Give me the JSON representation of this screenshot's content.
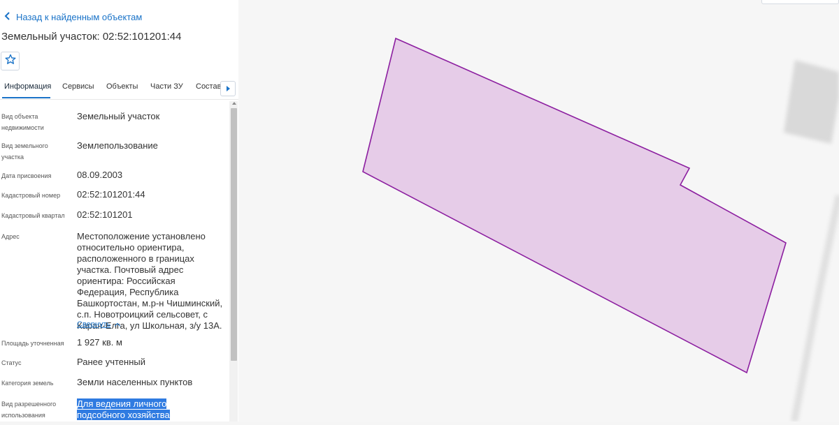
{
  "panel": {
    "back_label": "Назад к найденным объектам",
    "title": "Земельный участок: 02:52:101201:44",
    "tabs": [
      {
        "label": "Информация",
        "active": true
      },
      {
        "label": "Сервисы"
      },
      {
        "label": "Объекты"
      },
      {
        "label": "Части ЗУ"
      },
      {
        "label": "Состав"
      }
    ],
    "fields": [
      {
        "label": "Вид объекта недвижимости",
        "value": "Земельный участок"
      },
      {
        "label": "Вид земельного участка",
        "value": "Землепользование"
      },
      {
        "label": "Дата присвоения",
        "value": "08.09.2003"
      },
      {
        "label": "Кадастровый номер",
        "value": "02:52:101201:44"
      },
      {
        "label": "Кадастровый квартал",
        "value": "02:52:101201"
      },
      {
        "label": "Адрес",
        "value": "Местоположение установлено относительно ориентира, расположенного в границах участка. Почтовый адрес ориентира: Российская Федерация, Республика Башкортостан, м.р-н Чишминский, с.п. Новотроицкий сельсовет, с Каран-Елга, ул Школьная, з/у 13А."
      },
      {
        "label": "Площадь уточненная",
        "value": "1 927 кв. м"
      },
      {
        "label": "Статус",
        "value": "Ранее учтенный"
      },
      {
        "label": "Категория земель",
        "value": "Земли населенных пунктов"
      },
      {
        "label": "Вид разрешенного использования",
        "value": "Для ведения личного подсобного хозяйства"
      }
    ],
    "collapse_label": "Свернуть"
  },
  "map": {
    "parcel_fill": "#e6cce8",
    "parcel_stroke": "#8c1fa0",
    "building_fill": "#d9d9d9"
  },
  "colors": {
    "accent": "#1a73c8",
    "selection": "#2f7be1"
  },
  "icons": {
    "back": "chevron-left-icon",
    "favorite": "star-outline-icon",
    "tabs_scroll": "triangle-right-icon",
    "collapse": "chevron-up-icon"
  }
}
